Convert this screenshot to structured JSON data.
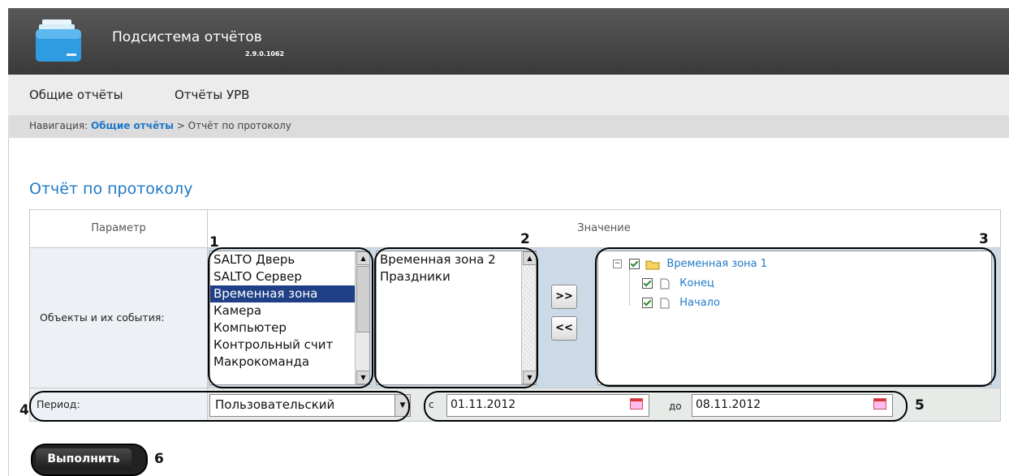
{
  "header": {
    "app_title": "Подсистема отчётов",
    "version": "2.9.0.1062"
  },
  "menu": {
    "items": [
      {
        "label": "Общие отчёты"
      },
      {
        "label": "Отчёты УРВ"
      }
    ]
  },
  "breadcrumb": {
    "prefix": "Навигация:",
    "link": "Общие отчёты",
    "separator": ">",
    "current": "Отчёт по протоколу"
  },
  "page": {
    "title": "Отчёт по протоколу"
  },
  "table": {
    "col_param": "Параметр",
    "col_value": "Значение",
    "objects_label": "Объекты и их события:",
    "period_label": "Период:"
  },
  "objects_list": {
    "items": [
      "SALTO Дверь",
      "SALTO Сервер",
      "Временная зона",
      "Камера",
      "Компьютер",
      "Контрольный счит",
      "Макрокоманда"
    ],
    "selected": "Временная зона"
  },
  "values_list": {
    "items": [
      "Временная зона 2",
      "Праздники"
    ]
  },
  "buttons": {
    "add": ">>",
    "remove": "<<",
    "run": "Выполнить"
  },
  "tree": {
    "root": "Временная зона 1",
    "children": [
      "Конец",
      "Начало"
    ]
  },
  "period": {
    "selected": "Пользовательский",
    "from_label": "с",
    "from": "01.11.2012",
    "to_label": "до",
    "to": "08.11.2012"
  },
  "callouts": [
    "1",
    "2",
    "3",
    "4",
    "5",
    "6"
  ],
  "colors": {
    "header_bg": "#4a4a4a",
    "accent": "#1f79c7",
    "selection": "#1f3f86"
  },
  "icons": [
    "app-folder-icon",
    "folder-icon",
    "file-icon",
    "calendar-icon",
    "tree-collapse-icon",
    "dropdown-arrow-icon"
  ]
}
